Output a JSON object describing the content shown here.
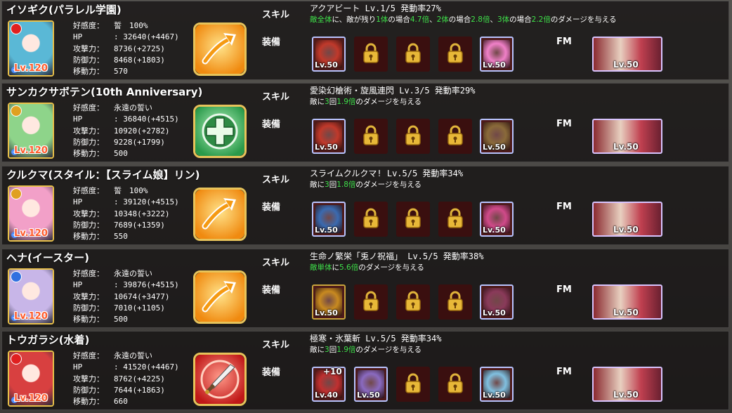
{
  "labels": {
    "skill": "スキル",
    "equip": "装備",
    "fm": "FM"
  },
  "stat_keys": [
    "好感度：",
    "HP",
    "攻撃力：",
    "防御力：",
    "移動力："
  ],
  "characters": [
    {
      "name": "イソギク(パラレル学園)",
      "level": "Lv.120",
      "element": "fire",
      "element_color": "#e02020",
      "art_color": "#5ab8d6",
      "class_type": "archer",
      "stats": [
        "誓　100%",
        ": 32640(+4467)",
        "8736(+2725)",
        "8468(+1803)",
        "570"
      ],
      "skill_title": "アクアビート Lv.1/5 発動率27%",
      "skill_desc": [
        {
          "t": "敵全体",
          "g": true
        },
        {
          "t": "に、敵が残り",
          "g": false
        },
        {
          "t": "1体",
          "g": true
        },
        {
          "t": "の場合",
          "g": false
        },
        {
          "t": "4.7倍",
          "g": true
        },
        {
          "t": "、",
          "g": false
        },
        {
          "t": "2体",
          "g": true
        },
        {
          "t": "の場合",
          "g": false
        },
        {
          "t": "2.8倍",
          "g": true
        },
        {
          "t": "、",
          "g": false
        },
        {
          "t": "3体",
          "g": true
        },
        {
          "t": "の場合",
          "g": false
        },
        {
          "t": "2.2倍",
          "g": true
        },
        {
          "t": "のダメージを与える",
          "g": false
        }
      ],
      "equips": [
        {
          "type": "item",
          "level": "Lv.50",
          "color": "#c0392b",
          "rare": true
        },
        {
          "type": "lock"
        },
        {
          "type": "lock"
        },
        {
          "type": "lock"
        },
        {
          "type": "item",
          "level": "Lv.50",
          "color": "#f080c8",
          "rare": true
        }
      ],
      "fm_level": "Lv.50"
    },
    {
      "name": "サンカクサボテン(10th Anniversary)",
      "level": "Lv.120",
      "element": "thunder",
      "element_color": "#e0a020",
      "art_color": "#8ed48a",
      "class_type": "healer",
      "stats": [
        "永遠の誓い",
        ": 36840(+4515)",
        "10920(+2782)",
        "9228(+1799)",
        "500"
      ],
      "skill_title": "愛染幻槍術・旋風連閃 Lv.3/5 発動率29%",
      "skill_desc": [
        {
          "t": "敵に",
          "g": false
        },
        {
          "t": "3",
          "g": true
        },
        {
          "t": "回",
          "g": false
        },
        {
          "t": "1.9倍",
          "g": true
        },
        {
          "t": "のダメージを与える",
          "g": false
        }
      ],
      "equips": [
        {
          "type": "item",
          "level": "Lv.50",
          "color": "#c0392b",
          "rare": true
        },
        {
          "type": "lock"
        },
        {
          "type": "lock"
        },
        {
          "type": "lock"
        },
        {
          "type": "item",
          "level": "Lv.50",
          "color": "#8a6a3a",
          "rare": true
        }
      ],
      "fm_level": "Lv.50"
    },
    {
      "name": "クルクマ(スタイル：【スライム娘】リン)",
      "level": "Lv.120",
      "element": "thunder",
      "element_color": "#e0a020",
      "art_color": "#f2a0c8",
      "class_type": "archer",
      "stats": [
        "誓　100%",
        ": 39120(+4515)",
        "10348(+3222)",
        "7689(+1359)",
        "550"
      ],
      "skill_title": "スライムクルクマ! Lv.5/5 発動率34%",
      "skill_desc": [
        {
          "t": "敵に",
          "g": false
        },
        {
          "t": "3",
          "g": true
        },
        {
          "t": "回",
          "g": false
        },
        {
          "t": "1.8倍",
          "g": true
        },
        {
          "t": "のダメージを与える",
          "g": false
        }
      ],
      "equips": [
        {
          "type": "item",
          "level": "Lv.50",
          "color": "#3a6ab0",
          "rare": true
        },
        {
          "type": "lock"
        },
        {
          "type": "lock"
        },
        {
          "type": "lock"
        },
        {
          "type": "item",
          "level": "Lv.50",
          "color": "#d04a8a",
          "rare": true
        }
      ],
      "fm_level": "Lv.50"
    },
    {
      "name": "ヘナ(イースター)",
      "level": "Lv.120",
      "element": "wind",
      "element_color": "#3070e0",
      "art_color": "#c8b6e8",
      "class_type": "archer",
      "stats": [
        "永遠の誓い",
        ": 39876(+4515)",
        "10674(+3477)",
        "7010(+1105)",
        "500"
      ],
      "skill_title": "生命ノ繁栄「兎ノ祝福」 Lv.5/5 発動率38%",
      "skill_desc": [
        {
          "t": "敵単体",
          "g": true
        },
        {
          "t": "に",
          "g": false
        },
        {
          "t": "5.6倍",
          "g": true
        },
        {
          "t": "のダメージを与える",
          "g": false
        }
      ],
      "equips": [
        {
          "type": "item",
          "level": "Lv.50",
          "color": "#c88a20",
          "rare": false
        },
        {
          "type": "lock"
        },
        {
          "type": "lock"
        },
        {
          "type": "lock"
        },
        {
          "type": "item",
          "level": "Lv.50",
          "color": "#8a3a5a",
          "rare": true
        }
      ],
      "fm_level": "Lv.50"
    },
    {
      "name": "トウガラシ(水着)",
      "level": "Lv.120",
      "element": "fire",
      "element_color": "#e02020",
      "art_color": "#d84040",
      "class_type": "sword",
      "stats": [
        "永遠の誓い",
        ": 41520(+4467)",
        "8762(+4225)",
        "7644(+1863)",
        "660"
      ],
      "skill_title": "極寒・氷葉斬 Lv.5/5 発動率34%",
      "skill_desc": [
        {
          "t": "敵に",
          "g": false
        },
        {
          "t": "3",
          "g": true
        },
        {
          "t": "回",
          "g": false
        },
        {
          "t": "1.9倍",
          "g": true
        },
        {
          "t": "のダメージを与える",
          "g": false
        }
      ],
      "equips": [
        {
          "type": "item",
          "level": "Lv.40",
          "color": "#c03030",
          "rare": true,
          "plus": "+10"
        },
        {
          "type": "item",
          "level": "Lv.50",
          "color": "#8a6ac0",
          "rare": true
        },
        {
          "type": "lock"
        },
        {
          "type": "lock"
        },
        {
          "type": "item",
          "level": "Lv.50",
          "color": "#80c0e0",
          "rare": true
        }
      ],
      "fm_level": "Lv.50"
    }
  ]
}
